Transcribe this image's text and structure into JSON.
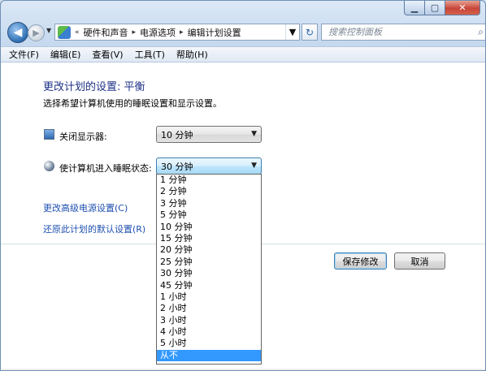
{
  "nav": {
    "breadcrumb_prefix": "«",
    "crumbs": [
      "硬件和声音",
      "电源选项",
      "编辑计划设置"
    ],
    "crumb_sep": "▸",
    "search_placeholder": "搜索控制面板"
  },
  "menu": [
    "文件(F)",
    "编辑(E)",
    "查看(V)",
    "工具(T)",
    "帮助(H)"
  ],
  "page": {
    "title": "更改计划的设置: 平衡",
    "subtitle": "选择希望计算机使用的睡眠设置和显示设置。"
  },
  "settings": {
    "display_off_label": "关闭显示器:",
    "display_off_value": "10 分钟",
    "sleep_label": "使计算机进入睡眠状态:",
    "sleep_value": "30 分钟"
  },
  "dropdown_options": [
    "1 分钟",
    "2 分钟",
    "3 分钟",
    "5 分钟",
    "10 分钟",
    "15 分钟",
    "20 分钟",
    "25 分钟",
    "30 分钟",
    "45 分钟",
    "1 小时",
    "2 小时",
    "3 小时",
    "4 小时",
    "5 小时",
    "从不"
  ],
  "dropdown_selected": "从不",
  "links": {
    "advanced": "更改高级电源设置(C)",
    "restore": "还原此计划的默认设置(R)"
  },
  "buttons": {
    "save": "保存修改",
    "cancel": "取消"
  },
  "icons": {
    "back": "back-arrow-icon",
    "forward": "forward-arrow-icon",
    "refresh": "refresh-icon",
    "search": "search-icon",
    "display": "monitor-icon",
    "sleep": "moon-icon"
  },
  "colors": {
    "accent_title": "#1e3287",
    "link": "#1e4fb0",
    "selection": "#3399ff"
  }
}
